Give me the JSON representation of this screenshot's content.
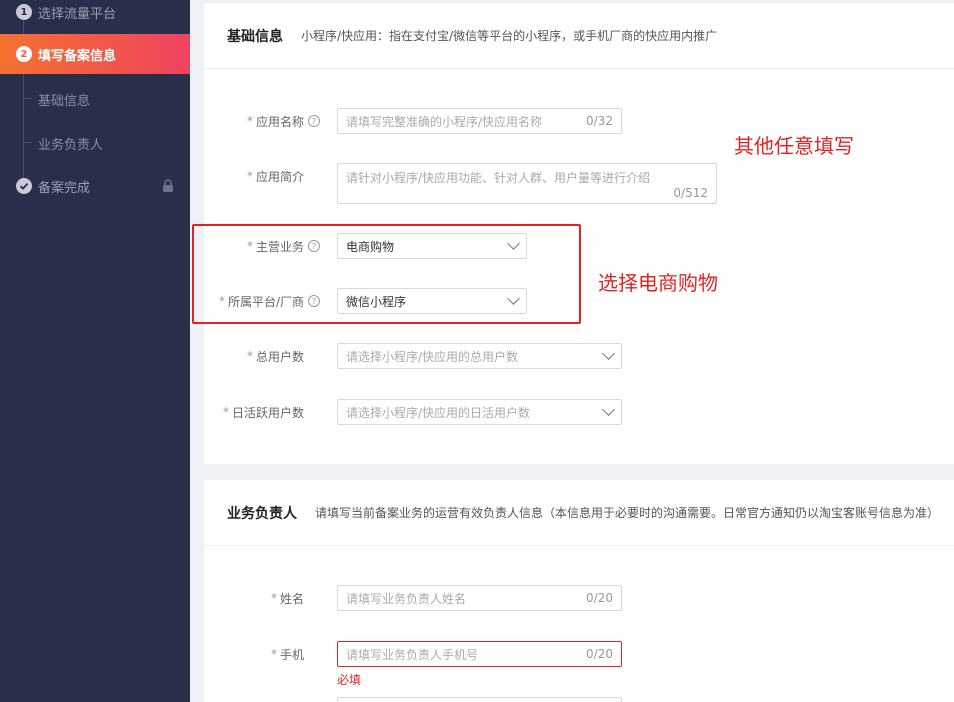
{
  "sidebar": {
    "steps": [
      {
        "num": "1",
        "label": "选择流量平台"
      },
      {
        "num": "2",
        "label": "填写备案信息"
      }
    ],
    "sub_items": [
      "基础信息",
      "业务负责人"
    ],
    "final_step": {
      "label": "备案完成"
    }
  },
  "basic": {
    "title": "基础信息",
    "desc": "小程序/快应用：指在支付宝/微信等平台的小程序，或手机厂商的快应用内推广",
    "app_name": {
      "label": "应用名称",
      "placeholder": "请填写完整准确的小程序/快应用名称",
      "count": "0/32"
    },
    "app_intro": {
      "label": "应用简介",
      "placeholder": "请针对小程序/快应用功能、针对人群、用户量等进行介绍",
      "count": "0/512"
    },
    "main_business": {
      "label": "主营业务",
      "value": "电商购物"
    },
    "platform": {
      "label": "所属平台/厂商",
      "value": "微信小程序"
    },
    "total_users": {
      "label": "总用户数",
      "placeholder": "请选择小程序/快应用的总用户数"
    },
    "daily_users": {
      "label": "日活跃用户数",
      "placeholder": "请选择小程序/快应用的日活用户数"
    }
  },
  "owner": {
    "title": "业务负责人",
    "desc": "请填写当前备案业务的运营有效负责人信息（本信息用于必要时的沟通需要。日常官方通知仍以淘宝客账号信息为准）",
    "name": {
      "label": "姓名",
      "placeholder": "请填写业务负责人姓名",
      "count": "0/20"
    },
    "phone": {
      "label": "手机",
      "placeholder": "请填写业务负责人手机号",
      "count": "0/20",
      "error": "必填"
    }
  },
  "annotations": {
    "other": "其他任意填写",
    "select": "选择电商购物"
  },
  "colors": {
    "accent_start": "#f4712f",
    "accent_end": "#ee4360",
    "error": "#e02424",
    "sidebar": "#2b2e4a"
  }
}
